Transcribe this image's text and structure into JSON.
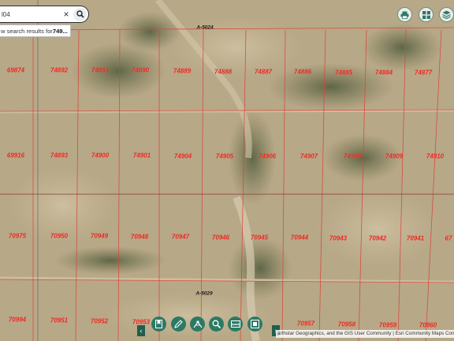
{
  "search": {
    "value": "l04",
    "suggestion_prefix": "w search results for ",
    "suggestion_term": "749..."
  },
  "icons": {
    "search": "search-icon",
    "clear": "close-icon",
    "print": "printer-icon",
    "basemap": "grid-icon",
    "layers": "layers-icon"
  },
  "colors": {
    "parcel_line": "#d9443a",
    "parcel_label": "#e8231b",
    "accent": "#2c7a64"
  },
  "roads": [
    {
      "label": "A-5024"
    },
    {
      "label": "A-5029"
    }
  ],
  "parcels": [
    "69874",
    "74892",
    "74891",
    "74890",
    "74889",
    "74888",
    "74887",
    "74886",
    "74885",
    "74884",
    "74877",
    "69916",
    "74893",
    "74900",
    "74901",
    "74904",
    "74905",
    "74906",
    "74907",
    "74908",
    "74909",
    "74910",
    "70975",
    "70950",
    "70949",
    "70948",
    "70947",
    "70946",
    "70945",
    "70944",
    "70943",
    "70942",
    "70941",
    "67",
    "70994",
    "70951",
    "70952",
    "70953",
    "70957",
    "70958",
    "70959",
    "70960"
  ],
  "toolbar": {
    "prev": "‹",
    "next": "›",
    "tools": [
      "bookmark-icon",
      "draw-icon",
      "measure-icon",
      "zoom-search-icon",
      "scalebar-icon",
      "overview-icon"
    ]
  },
  "attribution": "arthstar Geographics, and the GIS User Community | Esri Community Maps Contr"
}
